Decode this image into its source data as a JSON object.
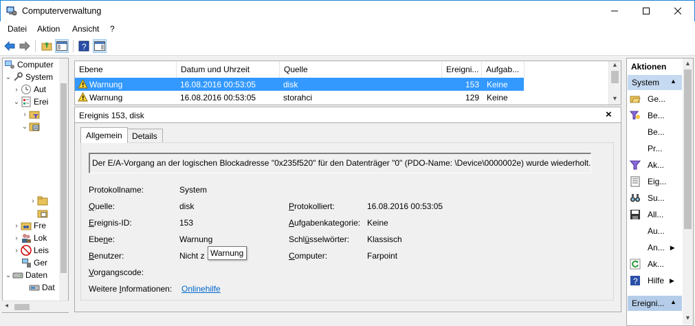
{
  "window": {
    "title": "Computerverwaltung"
  },
  "menu": [
    "Datei",
    "Aktion",
    "Ansicht",
    "?"
  ],
  "tree": {
    "root": "Computer",
    "system": "System",
    "aufgaben": "Aut",
    "ereignis": "Erei",
    "freigaben": "Fre",
    "lokale": "Lok",
    "leistung": "Leis",
    "geraete": "Ger",
    "datenspeicher": "Daten",
    "datentraeger": "Dat"
  },
  "event_list": {
    "columns": [
      "Ebene",
      "Datum und Uhrzeit",
      "Quelle",
      "Ereigni...",
      "Aufgab..."
    ],
    "rows": [
      {
        "level": "Warnung",
        "datetime": "16.08.2016 00:53:05",
        "source": "disk",
        "id": "153",
        "task": "Keine",
        "selected": true
      },
      {
        "level": "Warnung",
        "datetime": "16.08.2016 00:53:05",
        "source": "storahci",
        "id": "129",
        "task": "Keine",
        "selected": false
      }
    ]
  },
  "detail": {
    "header": "Ereignis 153, disk",
    "close": "×",
    "tabs": [
      "Allgemein",
      "Details"
    ],
    "message": "Der E/A-Vorgang an der logischen Blockadresse \"0x235f520\" für den Datenträger \"0\" (PDO-Name: \\Device\\0000002e) wurde wiederholt.",
    "fields": {
      "protokollname_label": "Protokollname:",
      "protokollname": "System",
      "quelle_label": "Quelle:",
      "quelle": "disk",
      "protokolliert_label": "Protokolliert:",
      "protokolliert": "16.08.2016 00:53:05",
      "ereignisid_label": "Ereignis-ID:",
      "ereignisid": "153",
      "aufgabenkategorie_label": "Aufgabenkategorie:",
      "aufgabenkategorie": "Keine",
      "ebene_label": "Ebene:",
      "ebene": "Warnung",
      "schluesselwoerter_label": "Schlüsselwörter:",
      "schluesselwoerter": "Klassisch",
      "benutzer_label": "Benutzer:",
      "benutzer": "Nicht z",
      "computer_label": "Computer:",
      "computer": "Farpoint",
      "vorgangscode_label": "Vorgangscode:",
      "weitere_label": "Weitere Informationen:",
      "onlinehilfe": "Onlinehilfe"
    },
    "tooltip": "Warnung"
  },
  "actions": {
    "header": "Aktionen",
    "section_system": "System",
    "items": [
      "Ge...",
      "Be...",
      "Be...",
      "Pr...",
      "Ak...",
      "Eig...",
      "Su...",
      "All...",
      "Au...",
      "An...",
      "Ak...",
      "Hilfe"
    ],
    "section_ereignis": "Ereigni..."
  },
  "colors": {
    "selection": "#3399ff",
    "accent": "#1883d7",
    "link": "#0066cc"
  }
}
